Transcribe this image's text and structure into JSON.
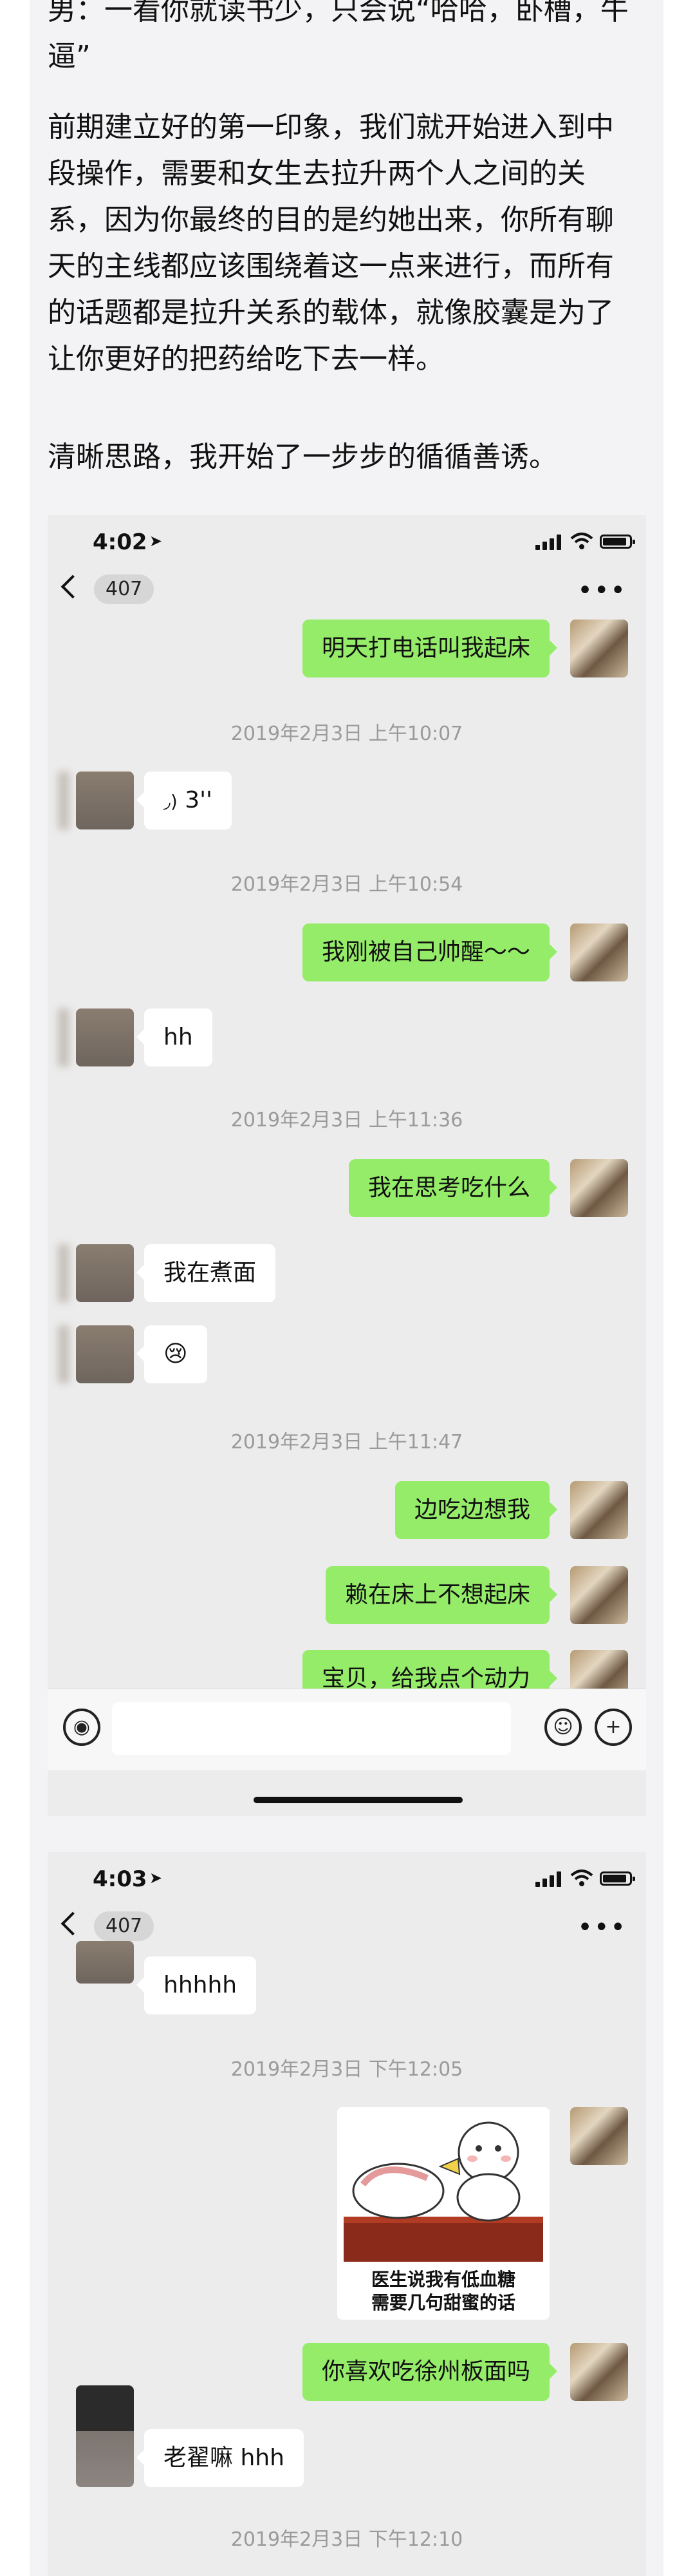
{
  "article": {
    "paragraphs": [
      "男：一看你就读书少，只会说“哈哈，卧槽，牛逼”",
      "前期建立好的第一印象，我们就开始进入到中段操作，需要和女生去拉升两个人之间的关系，因为你最终的目的是约她出来，你所有聊天的主线都应该围绕着这一点来进行，而所有的话题都是拉升关系的载体，就像胶囊是为了让你更好的把药给吃下去一样。",
      "清晰思路，我开始了一步步的循循善诱。"
    ]
  },
  "screenshots": [
    {
      "status_time": "4:02",
      "back_count": "407",
      "messages": [
        {
          "type": "text",
          "from": "me",
          "text": "明天打电话叫我起床"
        },
        {
          "type": "time",
          "text": "2019年2月3日 上午10:07"
        },
        {
          "type": "voice",
          "from": "them",
          "text": "3''"
        },
        {
          "type": "time",
          "text": "2019年2月3日 上午10:54"
        },
        {
          "type": "text",
          "from": "me",
          "text": "我刚被自己帅醒～～"
        },
        {
          "type": "text",
          "from": "them",
          "text": "hh"
        },
        {
          "type": "time",
          "text": "2019年2月3日 上午11:36"
        },
        {
          "type": "text",
          "from": "me",
          "text": "我在思考吃什么"
        },
        {
          "type": "text",
          "from": "them",
          "text": "我在煮面"
        },
        {
          "type": "text",
          "from": "them",
          "text": "😢"
        },
        {
          "type": "time",
          "text": "2019年2月3日 上午11:47"
        },
        {
          "type": "text",
          "from": "me",
          "text": "边吃边想我"
        },
        {
          "type": "text",
          "from": "me",
          "text": "赖在床上不想起床"
        },
        {
          "type": "text",
          "from": "me",
          "text": "宝贝，给我点个动力"
        }
      ]
    },
    {
      "status_time": "4:03",
      "back_count": "407",
      "messages": [
        {
          "type": "text",
          "from": "them",
          "text": "hhhhh"
        },
        {
          "type": "time",
          "text": "2019年2月3日 下午12:05"
        },
        {
          "type": "sticker",
          "from": "me",
          "caption_line1": "医生说我有低血糖",
          "caption_line2": "需要几句甜蜜的话"
        },
        {
          "type": "text",
          "from": "me",
          "text": "你喜欢吃徐州板面吗"
        },
        {
          "type": "text",
          "from": "them",
          "text": "老翟嘛 hhh"
        },
        {
          "type": "time",
          "text": "2019年2月3日 下午12:10"
        }
      ]
    }
  ],
  "icons": {
    "location": "location-arrow-icon",
    "signal": "signal-bars-icon",
    "wifi": "wifi-icon",
    "battery": "battery-icon",
    "back": "chevron-left-icon",
    "more": "more-dots-icon",
    "voice": "voice-wave-icon",
    "emoji": "emoji-icon",
    "add": "plus-icon"
  },
  "colors": {
    "my_bubble": "#95ec69",
    "their_bubble": "#ffffff",
    "chat_bg": "#ececec",
    "timestamp": "#9a9a9a"
  }
}
